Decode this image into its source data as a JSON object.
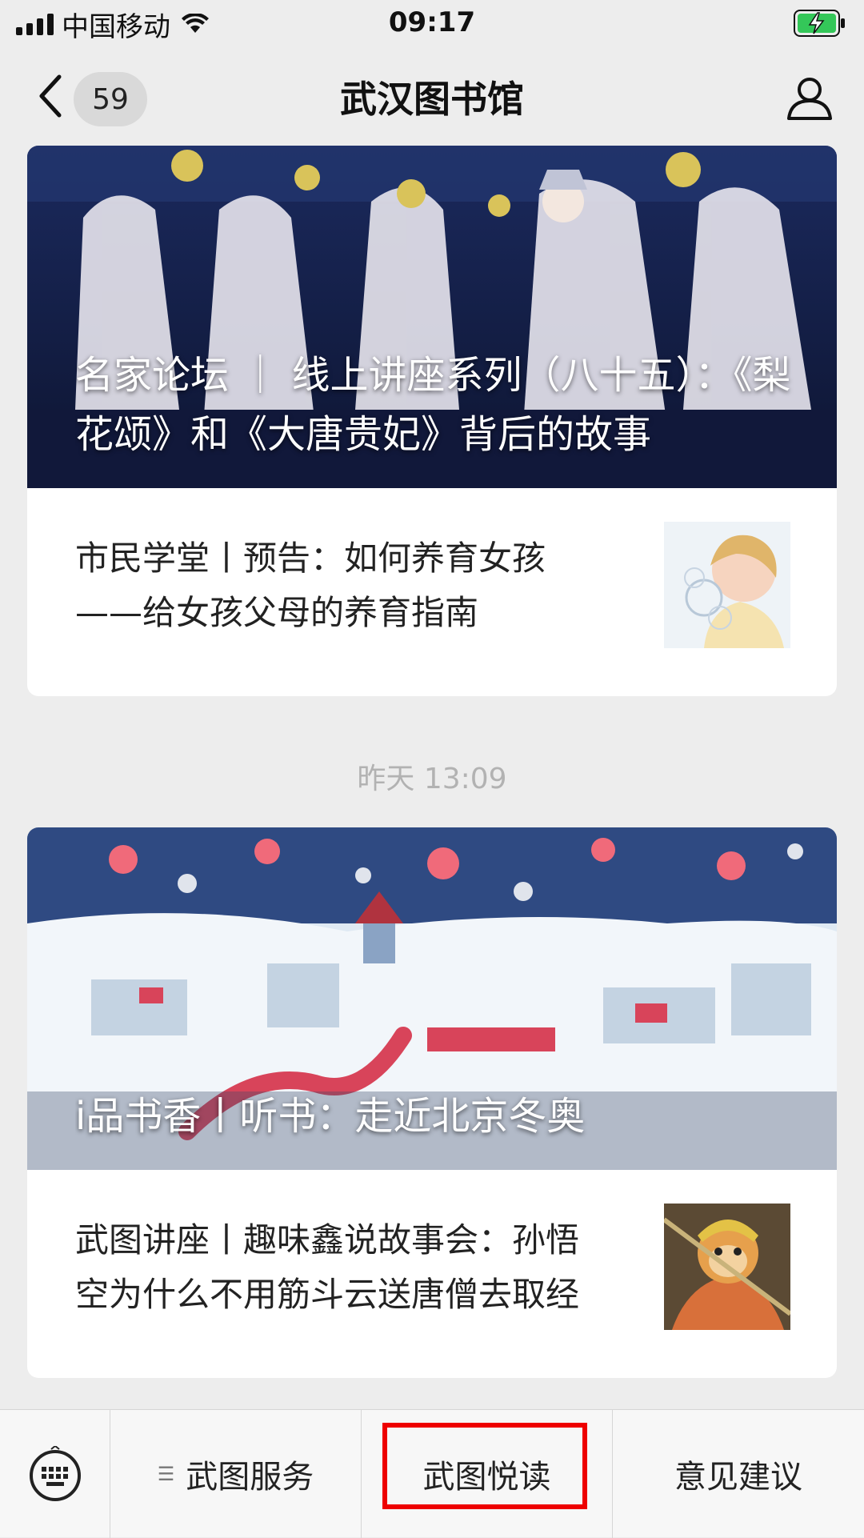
{
  "status_bar": {
    "carrier": "中国移动",
    "time": "09:17"
  },
  "nav": {
    "badge_count": "59",
    "title": "武汉图书馆"
  },
  "articles": [
    {
      "hero_title": "名家论坛 ｜ 线上讲座系列（八十五）：《梨花颂》和《大唐贵妃》背后的故事",
      "sub_title": "市民学堂丨预告：如何养育女孩——给女孩父母的养育指南"
    },
    {
      "hero_title": "i品书香丨听书：走近北京冬奥",
      "sub_title": "武图讲座丨趣味鑫说故事会：孙悟空为什么不用筋斗云送唐僧去取经"
    }
  ],
  "timestamp": "昨天 13:09",
  "bottom_menu": {
    "items": [
      "武图服务",
      "武图悦读",
      "意见建议"
    ],
    "highlighted": "武图悦读"
  },
  "colors": {
    "background": "#ededed",
    "highlight": "#ee0000",
    "battery": "#34c759"
  }
}
